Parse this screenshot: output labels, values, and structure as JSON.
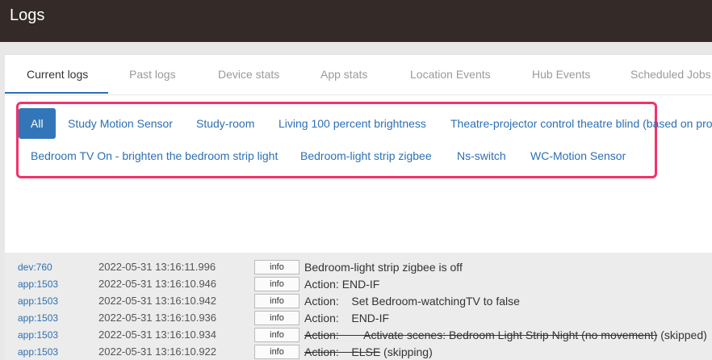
{
  "app": {
    "title": "Logs"
  },
  "tabs": [
    {
      "label": "Current logs"
    },
    {
      "label": "Past logs"
    },
    {
      "label": "Device stats"
    },
    {
      "label": "App stats"
    },
    {
      "label": "Location Events"
    },
    {
      "label": "Hub Events"
    },
    {
      "label": "Scheduled Jobs"
    }
  ],
  "filters": [
    {
      "label": "All"
    },
    {
      "label": "Study Motion Sensor"
    },
    {
      "label": "Study-room"
    },
    {
      "label": "Living 100 percent brightness"
    },
    {
      "label": "Theatre-projector control theatre blind (based on pro"
    },
    {
      "label": "Bedroom TV On - brighten the bedroom strip light"
    },
    {
      "label": "Bedroom-light strip zigbee"
    },
    {
      "label": "Ns-switch"
    },
    {
      "label": "WC-Motion Sensor"
    }
  ],
  "logs": [
    {
      "source": "dev:760",
      "time": "2022-05-31 13:16:11.996",
      "level": "info",
      "message": "Bedroom-light strip zigbee is off"
    },
    {
      "source": "app:1503",
      "time": "2022-05-31 13:16:10.946",
      "level": "info",
      "message": "Action: END-IF"
    },
    {
      "source": "app:1503",
      "time": "2022-05-31 13:16:10.942",
      "level": "info",
      "message": "Action:    Set Bedroom-watchingTV to false"
    },
    {
      "source": "app:1503",
      "time": "2022-05-31 13:16:10.936",
      "level": "info",
      "message": "Action:    END-IF"
    },
    {
      "source": "app:1503",
      "time": "2022-05-31 13:16:10.934",
      "level": "info",
      "message_struck": "Action:        Activate scenes: Bedroom Light Strip Night (no movement)",
      "message_tail": " (skipped)"
    },
    {
      "source": "app:1503",
      "time": "2022-05-31 13:16:10.922",
      "level": "info",
      "message_struck": "Action:    ELSE",
      "message_tail": " (skipping)"
    }
  ]
}
